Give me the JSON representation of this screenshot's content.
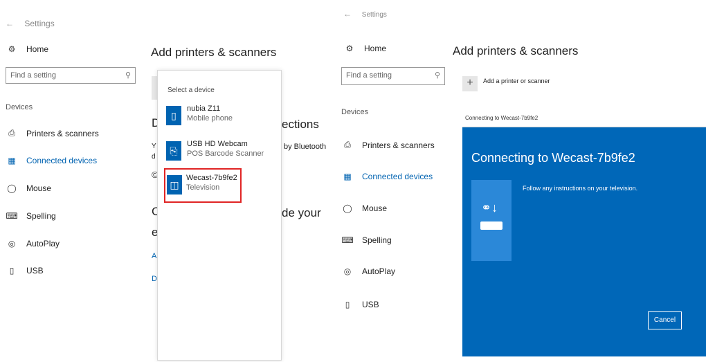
{
  "left": {
    "back_label": "Settings",
    "nav": {
      "home": "Home"
    },
    "search_placeholder": "Find a setting",
    "section": "Devices",
    "items": [
      {
        "label": "Printers & scanners"
      },
      {
        "label": "Connected devices"
      },
      {
        "label": "Mouse"
      },
      {
        "label": "Spelling"
      },
      {
        "label": "AutoPlay"
      },
      {
        "label": "USB"
      }
    ],
    "title": "Add printers & scanners",
    "frags": {
      "d_big": "D",
      "ections": "ections",
      "by_bt": "by Bluetooth",
      "y": "Y",
      "d_small": "d",
      "c_sym": "©",
      "c_big": "C",
      "de_your": "de your",
      "e": "e",
      "a_link": "A",
      "d_link": "D"
    },
    "picker": {
      "header": "Select a device",
      "devices": [
        {
          "name": "nubia Z11",
          "type": "Mobile phone"
        },
        {
          "name": "USB HD Webcam",
          "type": "POS Barcode Scanner"
        },
        {
          "name": "Wecast-7b9fe2",
          "type": "Television"
        }
      ]
    }
  },
  "right": {
    "back_label": "Settings",
    "nav": {
      "home": "Home"
    },
    "search_placeholder": "Find a setting",
    "section": "Devices",
    "items": [
      {
        "label": "Printers & scanners"
      },
      {
        "label": "Connected devices"
      },
      {
        "label": "Mouse"
      },
      {
        "label": "Spelling"
      },
      {
        "label": "AutoPlay"
      },
      {
        "label": "USB"
      }
    ],
    "title": "Add printers & scanners",
    "add_label": "Add a printer or scanner",
    "dialog": {
      "titlebar": "Connecting to Wecast-7b9fe2",
      "title": "Connecting to Wecast-7b9fe2",
      "instruction": "Follow any instructions on your television.",
      "cancel": "Cancel"
    }
  },
  "colors": {
    "accent": "#0063b1",
    "dialog_bg": "#0067b8",
    "highlight": "#e02424"
  }
}
